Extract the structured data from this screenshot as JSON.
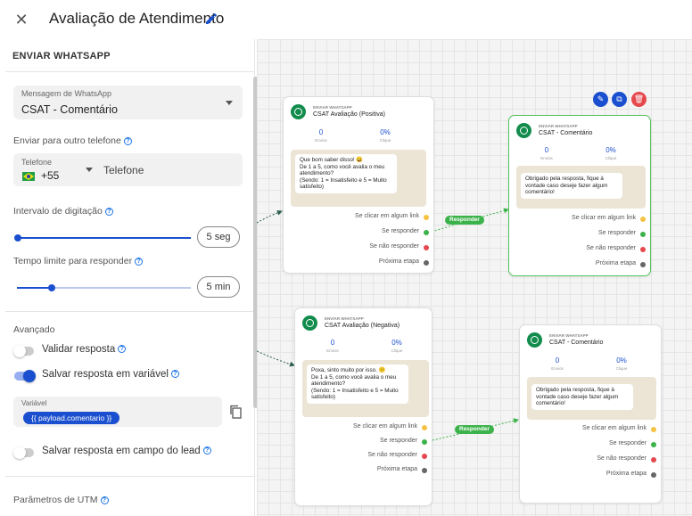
{
  "header": {
    "title": "Avaliação de Atendimento"
  },
  "sidebar": {
    "section_title": "ENVIAR WHATSAPP",
    "message_select": {
      "label": "Mensagem de WhatsApp",
      "value": "CSAT - Comentário"
    },
    "other_phone_label": "Enviar para outro telefone",
    "phone": {
      "label": "Telefone",
      "country_code": "+55",
      "placeholder": "Telefone"
    },
    "typing_interval": {
      "label": "Intervalo de digitação",
      "value": "5 seg"
    },
    "response_time": {
      "label": "Tempo limite para responder",
      "value": "5 min"
    },
    "advanced": {
      "title": "Avançado",
      "validate_response": {
        "label": "Validar resposta",
        "on": false
      },
      "save_variable": {
        "label": "Salvar resposta em variável",
        "on": true
      },
      "variable": {
        "label": "Variável",
        "value": "{{ payload.comentario }}"
      },
      "save_lead_field": {
        "label": "Salvar resposta em campo do lead",
        "on": false
      }
    },
    "utm_label": "Parâmetros de UTM"
  },
  "canvas": {
    "nodes": [
      {
        "kind": "ENVIAR WHATSAPP",
        "name": "CSAT Avaliação (Positiva)",
        "sent": "0",
        "sent_label": "Envios",
        "clicks": "0%",
        "clicks_label": "Clique",
        "message": "Que bom saber disso! 😀\nDe 1 a 5, como você avalia o meu atendimento?\n(Sendo: 1 = Insatisfeito e 5 = Muito satisfeito)",
        "outputs": [
          "Se clicar em algum link",
          "Se responder",
          "Se não responder",
          "Próxima etapa"
        ]
      },
      {
        "kind": "ENVIAR WHATSAPP",
        "name": "CSAT - Comentário",
        "sent": "0",
        "sent_label": "Envios",
        "clicks": "0%",
        "clicks_label": "Clique",
        "message": "Obrigado pela resposta, fique à vontade caso deseje fazer algum comentário!",
        "outputs": [
          "Se clicar em algum link",
          "Se responder",
          "Se não responder",
          "Próxima etapa"
        ]
      },
      {
        "kind": "ENVIAR WHATSAPP",
        "name": "CSAT Avaliação (Negativa)",
        "sent": "0",
        "sent_label": "Envios",
        "clicks": "0%",
        "clicks_label": "Clique",
        "message": "Poxa, sinto muito por isso. 😕\nDe 1 a 5, como você avalia o meu atendimento?\n(Sendo: 1 = Insatisfeito e 5 = Muito satisfeito)",
        "outputs": [
          "Se clicar em algum link",
          "Se responder",
          "Se não responder",
          "Próxima etapa"
        ]
      },
      {
        "kind": "ENVIAR WHATSAPP",
        "name": "CSAT - Comentário",
        "sent": "0",
        "sent_label": "Envios",
        "clicks": "0%",
        "clicks_label": "Clique",
        "message": "Obrigado pela resposta, fique à vontade caso deseje fazer algum comentário!",
        "outputs": [
          "Se clicar em algum link",
          "Se responder",
          "Se não responder",
          "Próxima etapa"
        ]
      }
    ],
    "edge_labels": [
      "Responder",
      "Responder"
    ],
    "output_colors": [
      "#f5c242",
      "#3cb24a",
      "#e5484d",
      "#666666"
    ]
  }
}
